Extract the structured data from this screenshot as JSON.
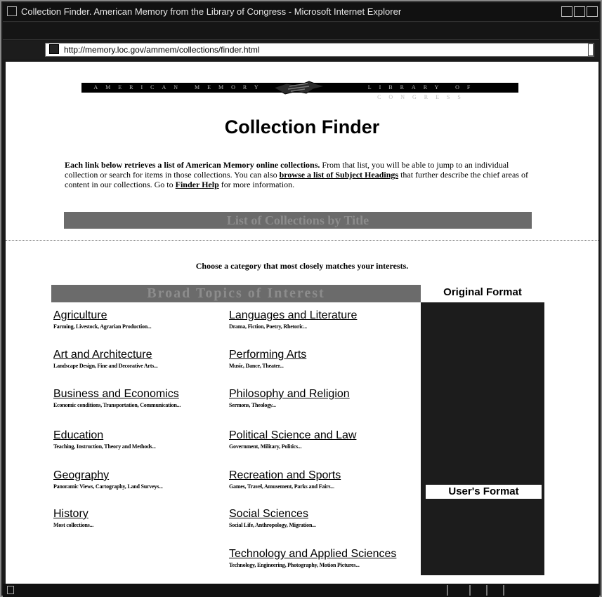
{
  "window": {
    "title": "Collection Finder. American Memory from the Library of Congress - Microsoft Internet Explorer",
    "address": "http://memory.loc.gov/ammem/collections/finder.html"
  },
  "banner": {
    "left_text": "AMERICAN MEMORY",
    "right_text": "LIBRARY OF CONGRESS"
  },
  "page": {
    "title": "Collection Finder",
    "intro": {
      "lead": "Each link below retrieves a list of American Memory online collections.",
      "text1": " From that list, you will be able to jump to an individual collection or search for items in those collections. You can also ",
      "link1": "browse a list of Subject Headings",
      "text2": " that further describe the chief areas of content in our collections. Go to ",
      "link2": "Finder Help",
      "text3": " for more information."
    },
    "by_title_label": "List of Collections by Title",
    "choose_text": "Choose a category that most closely matches your interests.",
    "broad_topics_label": "Broad Topics of Interest",
    "original_format_label": "Original Format",
    "users_format_label": "User's Format"
  },
  "topics": {
    "left": [
      {
        "name": "Agriculture",
        "sub": "Farming, Livestock, Agrarian Production..."
      },
      {
        "name": "Art and Architecture",
        "sub": "Landscape Design, Fine and Decorative Arts..."
      },
      {
        "name": "Business and Economics",
        "sub": "Economic conditions, Transportation, Communication..."
      },
      {
        "name": "Education",
        "sub": "Teaching, Instruction, Theory and Methods..."
      },
      {
        "name": "Geography",
        "sub": "Panoramic Views, Cartography, Land Surveys..."
      },
      {
        "name": "History",
        "sub": "Most collections..."
      }
    ],
    "right": [
      {
        "name": "Languages and Literature",
        "sub": "Drama, Fiction, Poetry, Rhetoric..."
      },
      {
        "name": "Performing Arts",
        "sub": "Music, Dance, Theater..."
      },
      {
        "name": "Philosophy and Religion",
        "sub": "Sermons, Theology..."
      },
      {
        "name": "Political Science and Law",
        "sub": "Government, Military, Politics..."
      },
      {
        "name": "Recreation and Sports",
        "sub": "Games, Travel, Amusement, Parks and Fairs..."
      },
      {
        "name": "Social Sciences",
        "sub": "Social Life, Anthropology, Migration..."
      },
      {
        "name": "Technology and Applied Sciences",
        "sub": "Technology, Engineering, Photography, Motion Pictures..."
      }
    ]
  }
}
